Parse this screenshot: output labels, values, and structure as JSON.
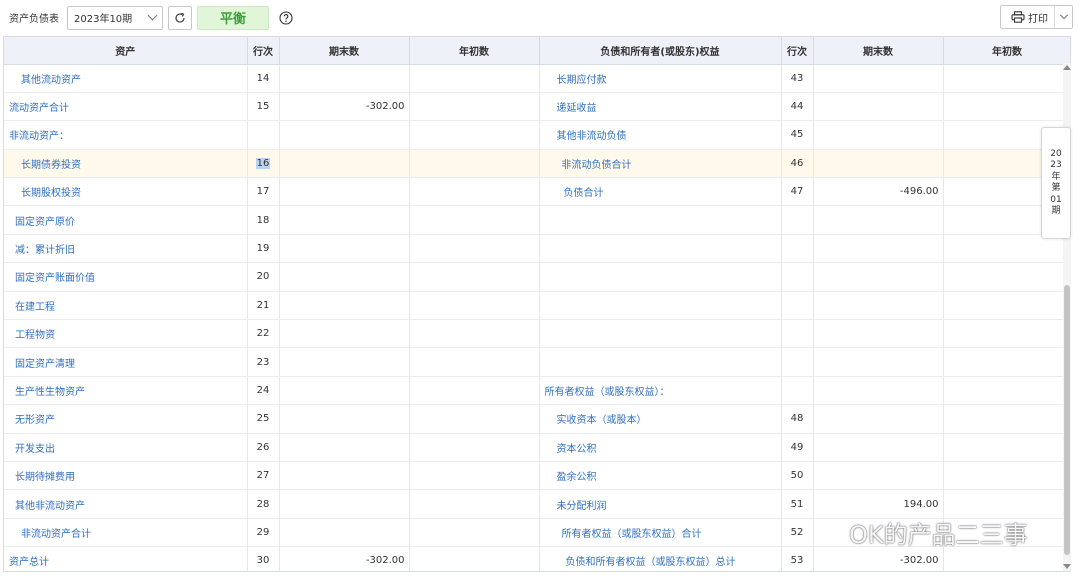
{
  "toolbar": {
    "report_title": "资产负债表",
    "period_value": "2023年10期",
    "balance_label": "平衡",
    "print_label": "打印"
  },
  "columns": [
    "资产",
    "行次",
    "期末数",
    "年初数",
    "负债和所有者(或股东)权益",
    "行次",
    "期末数",
    "年初数"
  ],
  "rows": [
    {
      "a_name": "其他流动资产",
      "a_line": "14",
      "a_end": "",
      "a_begin": "",
      "l_name": "长期应付款",
      "l_line": "43",
      "l_end": "",
      "l_begin": ""
    },
    {
      "a_name": "流动资产合计",
      "a_line": "15",
      "a_end": "-302.00",
      "a_begin": "",
      "l_name": "递延收益",
      "l_line": "44",
      "l_end": "",
      "l_begin": ""
    },
    {
      "a_name": "非流动资产：",
      "a_line": "",
      "a_end": "",
      "a_begin": "",
      "l_name": "其他非流动负债",
      "l_line": "45",
      "l_end": "",
      "l_begin": ""
    },
    {
      "a_name": "长期债券投资",
      "a_line": "16",
      "a_end": "",
      "a_begin": "",
      "l_name": "非流动负债合计",
      "l_line": "46",
      "l_end": "",
      "l_begin": ""
    },
    {
      "a_name": "长期股权投资",
      "a_line": "17",
      "a_end": "",
      "a_begin": "",
      "l_name": "负债合计",
      "l_line": "47",
      "l_end": "-496.00",
      "l_begin": ""
    },
    {
      "a_name": "固定资产原价",
      "a_line": "18",
      "a_end": "",
      "a_begin": "",
      "l_name": "",
      "l_line": "",
      "l_end": "",
      "l_begin": ""
    },
    {
      "a_name": "减：累计折旧",
      "a_line": "19",
      "a_end": "",
      "a_begin": "",
      "l_name": "",
      "l_line": "",
      "l_end": "",
      "l_begin": ""
    },
    {
      "a_name": "固定资产账面价值",
      "a_line": "20",
      "a_end": "",
      "a_begin": "",
      "l_name": "",
      "l_line": "",
      "l_end": "",
      "l_begin": ""
    },
    {
      "a_name": "在建工程",
      "a_line": "21",
      "a_end": "",
      "a_begin": "",
      "l_name": "",
      "l_line": "",
      "l_end": "",
      "l_begin": ""
    },
    {
      "a_name": "工程物资",
      "a_line": "22",
      "a_end": "",
      "a_begin": "",
      "l_name": "",
      "l_line": "",
      "l_end": "",
      "l_begin": ""
    },
    {
      "a_name": "固定资产清理",
      "a_line": "23",
      "a_end": "",
      "a_begin": "",
      "l_name": "",
      "l_line": "",
      "l_end": "",
      "l_begin": ""
    },
    {
      "a_name": "生产性生物资产",
      "a_line": "24",
      "a_end": "",
      "a_begin": "",
      "l_name": "所有者权益（或股东权益）：",
      "l_line": "",
      "l_end": "",
      "l_begin": ""
    },
    {
      "a_name": "无形资产",
      "a_line": "25",
      "a_end": "",
      "a_begin": "",
      "l_name": "实收资本（或股本）",
      "l_line": "48",
      "l_end": "",
      "l_begin": ""
    },
    {
      "a_name": "开发支出",
      "a_line": "26",
      "a_end": "",
      "a_begin": "",
      "l_name": "资本公积",
      "l_line": "49",
      "l_end": "",
      "l_begin": ""
    },
    {
      "a_name": "长期待摊费用",
      "a_line": "27",
      "a_end": "",
      "a_begin": "",
      "l_name": "盈余公积",
      "l_line": "50",
      "l_end": "",
      "l_begin": ""
    },
    {
      "a_name": "其他非流动资产",
      "a_line": "28",
      "a_end": "",
      "a_begin": "",
      "l_name": "未分配利润",
      "l_line": "51",
      "l_end": "194.00",
      "l_begin": ""
    },
    {
      "a_name": "非流动资产合计",
      "a_line": "29",
      "a_end": "",
      "a_begin": "",
      "l_name": "所有者权益（或股东权益）合计",
      "l_line": "52",
      "l_end": "",
      "l_begin": ""
    },
    {
      "a_name": "资产总计",
      "a_line": "30",
      "a_end": "-302.00",
      "a_begin": "",
      "l_name": "负债和所有者权益（或股东权益）总计",
      "l_line": "53",
      "l_end": "-302.00",
      "l_begin": ""
    }
  ],
  "side_tag": "2023年第01期",
  "watermark": "OK的产品二三事"
}
